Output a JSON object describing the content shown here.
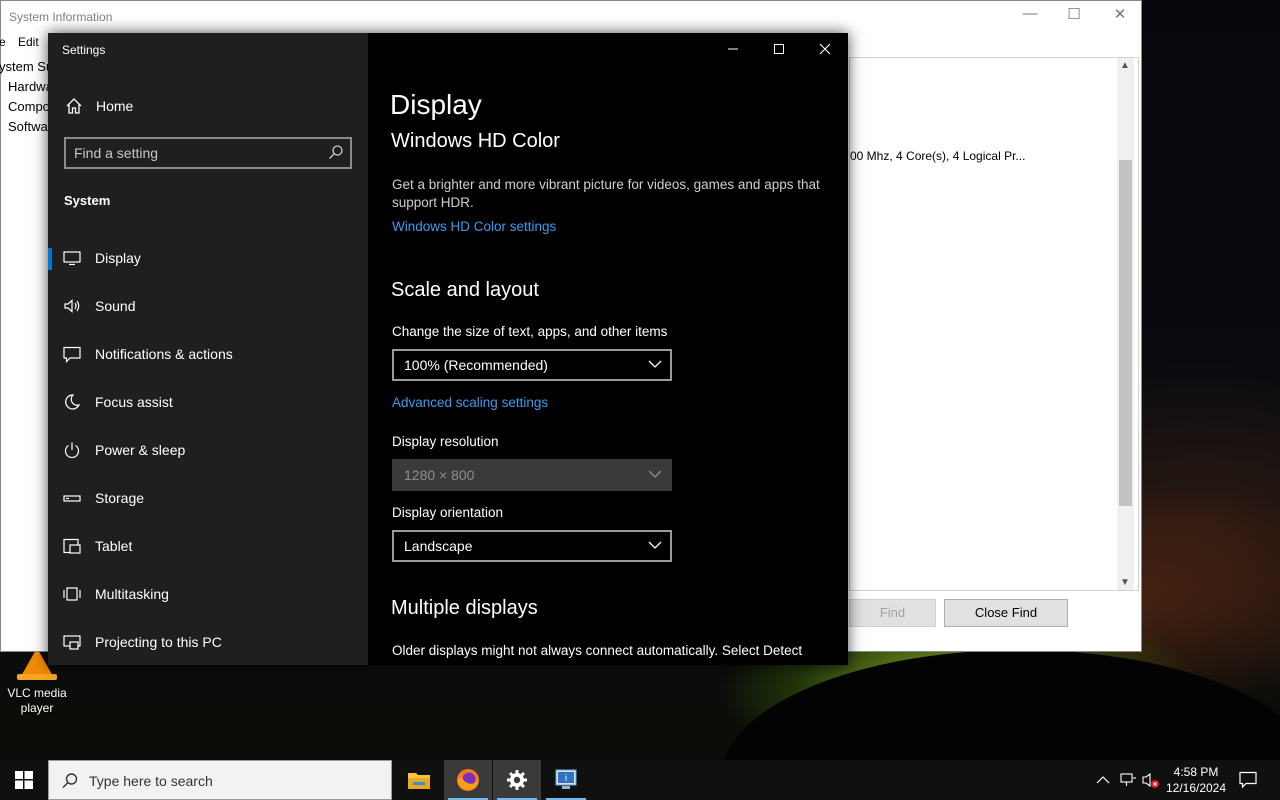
{
  "system_information": {
    "title": "System Information",
    "menu": [
      "e",
      "Edit"
    ],
    "tree": [
      "ystem Su",
      "Hardwa",
      "Compo",
      "Softwa"
    ],
    "row_text": "00 Mhz, 4 Core(s), 4 Logical Pr...",
    "find_label": "Find",
    "close_find_label": "Close Find"
  },
  "desktop": {
    "vlc_label": "VLC media player"
  },
  "settings": {
    "window_title": "Settings",
    "home_label": "Home",
    "search_placeholder": "Find a setting",
    "section": "System",
    "nav": [
      {
        "label": "Display",
        "icon": "monitor-icon",
        "active": true
      },
      {
        "label": "Sound",
        "icon": "speaker-icon"
      },
      {
        "label": "Notifications & actions",
        "icon": "notification-icon"
      },
      {
        "label": "Focus assist",
        "icon": "moon-icon"
      },
      {
        "label": "Power & sleep",
        "icon": "power-icon"
      },
      {
        "label": "Storage",
        "icon": "storage-icon"
      },
      {
        "label": "Tablet",
        "icon": "tablet-icon"
      },
      {
        "label": "Multitasking",
        "icon": "multitasking-icon"
      },
      {
        "label": "Projecting to this PC",
        "icon": "projector-icon"
      }
    ],
    "page_title": "Display",
    "hd_color": {
      "heading": "Windows HD Color",
      "description": "Get a brighter and more vibrant picture for videos, games and apps that support HDR.",
      "link": "Windows HD Color settings"
    },
    "scale": {
      "heading": "Scale and layout",
      "scale_label": "Change the size of text, apps, and other items",
      "scale_value": "100% (Recommended)",
      "advanced_link": "Advanced scaling settings",
      "resolution_label": "Display resolution",
      "resolution_value": "1280 × 800",
      "orientation_label": "Display orientation",
      "orientation_value": "Landscape"
    },
    "multiple": {
      "heading": "Multiple displays",
      "description": "Older displays might not always connect automatically. Select Detect"
    }
  },
  "taskbar": {
    "search_placeholder": "Type here to search",
    "time": "4:58 PM",
    "date": "12/16/2024"
  },
  "colors": {
    "accent": "#0078d7",
    "link": "#3a9cef",
    "nav_bg": "#1f1f1f"
  }
}
